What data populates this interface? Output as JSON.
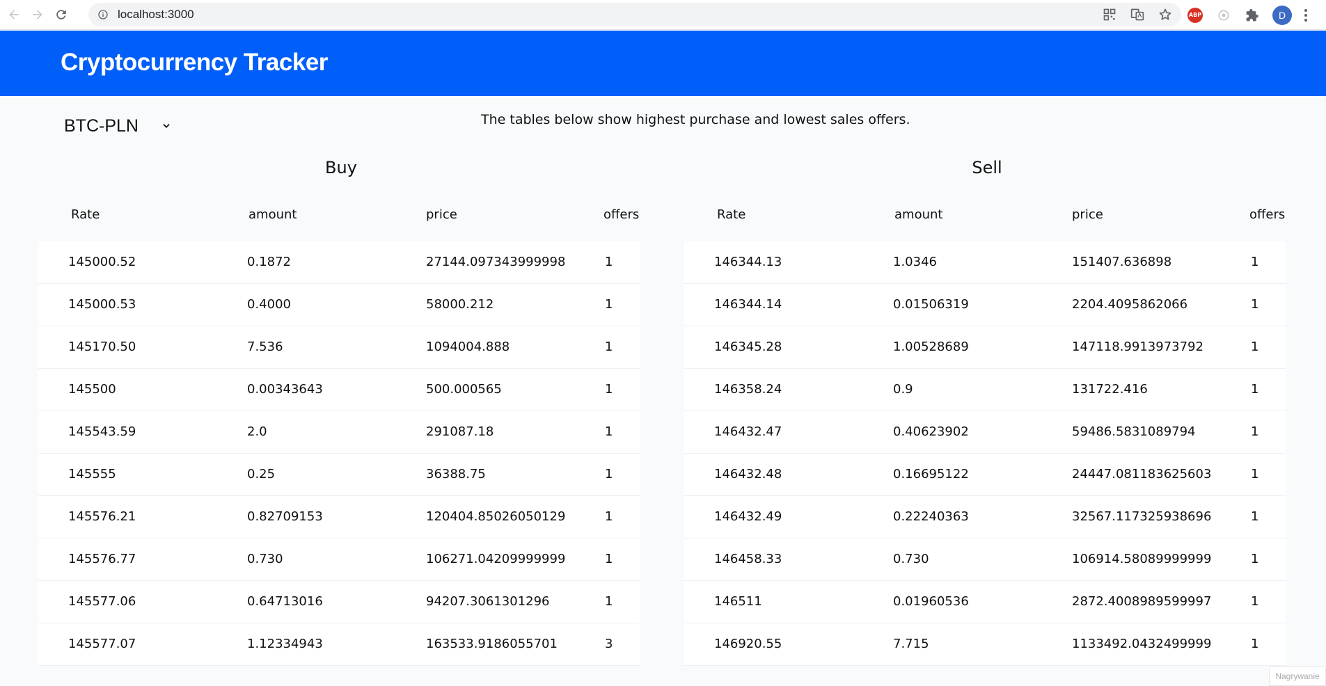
{
  "browser": {
    "url": "localhost:3000",
    "avatar_letter": "D",
    "abp_label": "ABP"
  },
  "header": {
    "title": "Cryptocurrency Tracker"
  },
  "controls": {
    "pair_selected": "BTC-PLN",
    "subtitle": "The tables below show highest purchase and lowest sales offers."
  },
  "columns": [
    "Rate",
    "amount",
    "price",
    "offers"
  ],
  "buy": {
    "title": "Buy",
    "rows": [
      [
        "145000.52",
        "0.1872",
        "27144.097343999998",
        "1"
      ],
      [
        "145000.53",
        "0.4000",
        "58000.212",
        "1"
      ],
      [
        "145170.50",
        "7.536",
        "1094004.888",
        "1"
      ],
      [
        "145500",
        "0.00343643",
        "500.000565",
        "1"
      ],
      [
        "145543.59",
        "2.0",
        "291087.18",
        "1"
      ],
      [
        "145555",
        "0.25",
        "36388.75",
        "1"
      ],
      [
        "145576.21",
        "0.82709153",
        "120404.85026050129",
        "1"
      ],
      [
        "145576.77",
        "0.730",
        "106271.04209999999",
        "1"
      ],
      [
        "145577.06",
        "0.64713016",
        "94207.3061301296",
        "1"
      ],
      [
        "145577.07",
        "1.12334943",
        "163533.9186055701",
        "3"
      ]
    ]
  },
  "sell": {
    "title": "Sell",
    "rows": [
      [
        "146344.13",
        "1.0346",
        "151407.636898",
        "1"
      ],
      [
        "146344.14",
        "0.01506319",
        "2204.4095862066",
        "1"
      ],
      [
        "146345.28",
        "1.00528689",
        "147118.9913973792",
        "1"
      ],
      [
        "146358.24",
        "0.9",
        "131722.416",
        "1"
      ],
      [
        "146432.47",
        "0.40623902",
        "59486.5831089794",
        "1"
      ],
      [
        "146432.48",
        "0.16695122",
        "24447.081183625603",
        "1"
      ],
      [
        "146432.49",
        "0.22240363",
        "32567.117325938696",
        "1"
      ],
      [
        "146458.33",
        "0.730",
        "106914.58089999999",
        "1"
      ],
      [
        "146511",
        "0.01960536",
        "2872.4008989599997",
        "1"
      ],
      [
        "146920.55",
        "7.715",
        "1133492.0432499999",
        "1"
      ]
    ]
  },
  "watermark": "Nagrywanie"
}
